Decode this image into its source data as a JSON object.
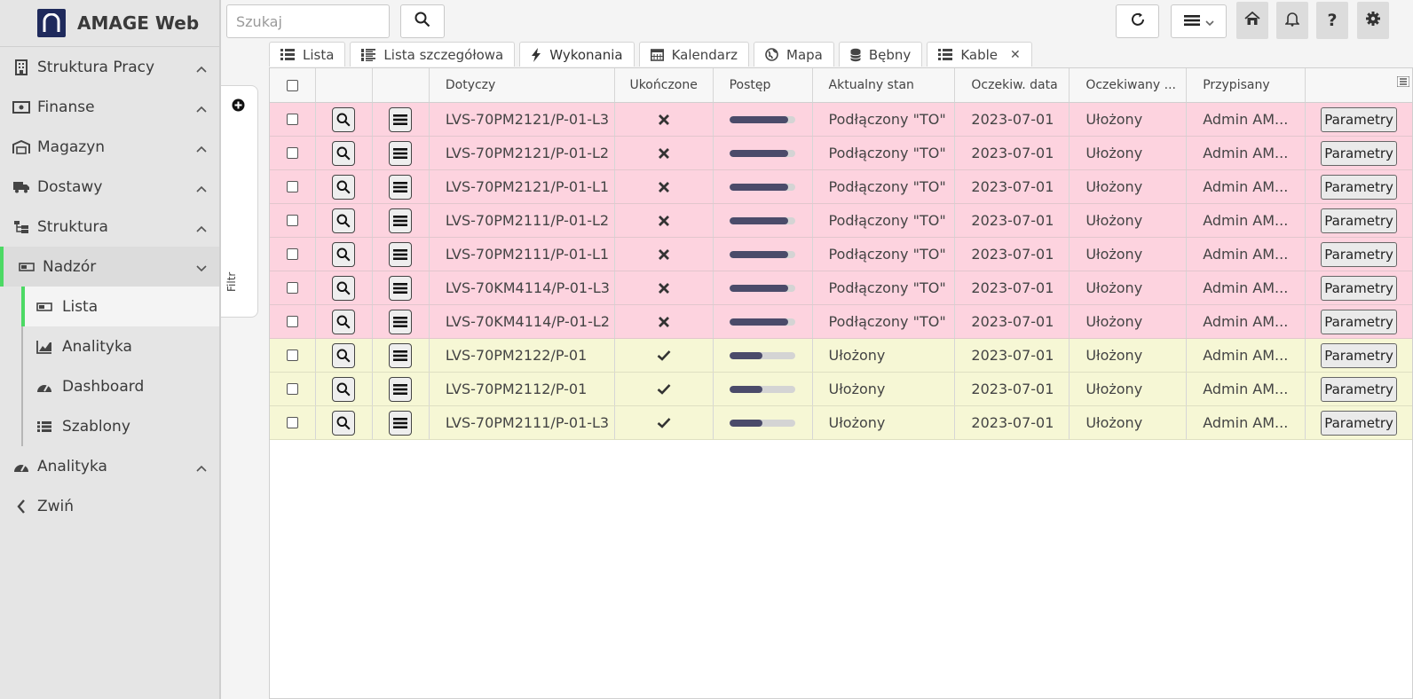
{
  "app": {
    "title": "AMAGE Web"
  },
  "sidebar": {
    "items": [
      {
        "label": "Struktura Pracy",
        "icon": "building-icon"
      },
      {
        "label": "Finanse",
        "icon": "money-icon"
      },
      {
        "label": "Magazyn",
        "icon": "warehouse-icon"
      },
      {
        "label": "Dostawy",
        "icon": "truck-icon"
      },
      {
        "label": "Struktura",
        "icon": "sitemap-icon"
      }
    ],
    "active": {
      "label": "Nadzór",
      "icon": "nadzor-icon"
    },
    "subitems": [
      {
        "label": "Lista",
        "icon": "list-icon"
      },
      {
        "label": "Analityka",
        "icon": "chart-icon"
      },
      {
        "label": "Dashboard",
        "icon": "gauge-icon"
      },
      {
        "label": "Szablony",
        "icon": "list-bullets-icon"
      }
    ],
    "bottom": [
      {
        "label": "Analityka",
        "icon": "gauge-icon"
      },
      {
        "label": "Zwiń",
        "icon": "chevron-left-icon"
      }
    ]
  },
  "topbar": {
    "search_placeholder": "Szukaj"
  },
  "filter": {
    "label": "Filtr"
  },
  "tabs": [
    {
      "label": "Lista",
      "icon": "list-icon"
    },
    {
      "label": "Lista szczegółowa",
      "icon": "list-detail-icon"
    },
    {
      "label": "Wykonania",
      "icon": "bolt-icon"
    },
    {
      "label": "Kalendarz",
      "icon": "calendar-icon"
    },
    {
      "label": "Mapa",
      "icon": "globe-icon"
    },
    {
      "label": "Bębny",
      "icon": "database-icon"
    },
    {
      "label": "Kable",
      "icon": "list-icon"
    }
  ],
  "grid": {
    "columns": {
      "dotyczy": "Dotyczy",
      "ukonczone": "Ukończone",
      "postep": "Postęp",
      "stan": "Aktualny stan",
      "data": "Oczekiw. data",
      "oczekiwany": "Oczekiwany ...",
      "przypisany": "Przypisany"
    },
    "rows": [
      {
        "dotyczy": "LVS-70PM2121/P-01-L3",
        "done": false,
        "progress": 0.9,
        "stan": "Podłączony \"TO\"",
        "data": "2023-07-01",
        "oczekiwany": "Ułożony",
        "przypisany": "Admin AM...",
        "button": "Parametry",
        "color": "red"
      },
      {
        "dotyczy": "LVS-70PM2121/P-01-L2",
        "done": false,
        "progress": 0.9,
        "stan": "Podłączony \"TO\"",
        "data": "2023-07-01",
        "oczekiwany": "Ułożony",
        "przypisany": "Admin AM...",
        "button": "Parametry",
        "color": "red"
      },
      {
        "dotyczy": "LVS-70PM2121/P-01-L1",
        "done": false,
        "progress": 0.9,
        "stan": "Podłączony \"TO\"",
        "data": "2023-07-01",
        "oczekiwany": "Ułożony",
        "przypisany": "Admin AM...",
        "button": "Parametry",
        "color": "red"
      },
      {
        "dotyczy": "LVS-70PM2111/P-01-L2",
        "done": false,
        "progress": 0.9,
        "stan": "Podłączony \"TO\"",
        "data": "2023-07-01",
        "oczekiwany": "Ułożony",
        "przypisany": "Admin AM...",
        "button": "Parametry",
        "color": "red"
      },
      {
        "dotyczy": "LVS-70PM2111/P-01-L1",
        "done": false,
        "progress": 0.9,
        "stan": "Podłączony \"TO\"",
        "data": "2023-07-01",
        "oczekiwany": "Ułożony",
        "przypisany": "Admin AM...",
        "button": "Parametry",
        "color": "red"
      },
      {
        "dotyczy": "LVS-70KM4114/P-01-L3",
        "done": false,
        "progress": 0.9,
        "stan": "Podłączony \"TO\"",
        "data": "2023-07-01",
        "oczekiwany": "Ułożony",
        "przypisany": "Admin AM...",
        "button": "Parametry",
        "color": "red"
      },
      {
        "dotyczy": "LVS-70KM4114/P-01-L2",
        "done": false,
        "progress": 0.9,
        "stan": "Podłączony \"TO\"",
        "data": "2023-07-01",
        "oczekiwany": "Ułożony",
        "przypisany": "Admin AM...",
        "button": "Parametry",
        "color": "red"
      },
      {
        "dotyczy": "LVS-70PM2122/P-01",
        "done": true,
        "progress": 0.5,
        "stan": "Ułożony",
        "data": "2023-07-01",
        "oczekiwany": "Ułożony",
        "przypisany": "Admin AM...",
        "button": "Parametry",
        "color": "yellow"
      },
      {
        "dotyczy": "LVS-70PM2112/P-01",
        "done": true,
        "progress": 0.5,
        "stan": "Ułożony",
        "data": "2023-07-01",
        "oczekiwany": "Ułożony",
        "przypisany": "Admin AM...",
        "button": "Parametry",
        "color": "yellow"
      },
      {
        "dotyczy": "LVS-70PM2111/P-01-L3",
        "done": true,
        "progress": 0.5,
        "stan": "Ułożony",
        "data": "2023-07-01",
        "oczekiwany": "Ułożony",
        "przypisany": "Admin AM...",
        "button": "Parametry",
        "color": "yellow"
      }
    ]
  },
  "colors": {
    "accent": "#4cd964",
    "row_red": "#fdd3df",
    "row_yellow": "#f6f7d5",
    "progress_fill": "#4b4b6a",
    "logo": "#1f2a5c"
  }
}
